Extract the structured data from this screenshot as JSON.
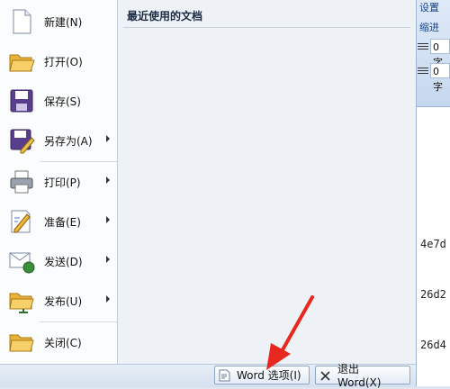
{
  "background_document": {
    "ribbon_tab": "设置",
    "indent_label": "缩进",
    "spin_1": "0 字",
    "spin_2": "0 字",
    "lines": [
      "4e7d",
      "26d2",
      "26d4"
    ]
  },
  "menu": {
    "recent_title": "最近使用的文档",
    "items": [
      {
        "label": "新建(N)",
        "icon": "new-document-icon",
        "submenu": false
      },
      {
        "label": "打开(O)",
        "icon": "open-folder-icon",
        "submenu": false
      },
      {
        "label": "保存(S)",
        "icon": "save-disk-icon",
        "submenu": false
      },
      {
        "label": "另存为(A)",
        "icon": "save-as-icon",
        "submenu": true
      },
      {
        "label": "打印(P)",
        "icon": "printer-icon",
        "submenu": true
      },
      {
        "label": "准备(E)",
        "icon": "prepare-document-icon",
        "submenu": true
      },
      {
        "label": "发送(D)",
        "icon": "send-mail-icon",
        "submenu": true
      },
      {
        "label": "发布(U)",
        "icon": "publish-folder-icon",
        "submenu": true
      },
      {
        "label": "关闭(C)",
        "icon": "close-folder-icon",
        "submenu": false
      }
    ]
  },
  "footer": {
    "word_options": "Word 选项(I)",
    "exit_word": "退出 Word(X)"
  },
  "colors": {
    "annotation_arrow": "#e8281e",
    "menu_border": "#9fb6d3"
  }
}
